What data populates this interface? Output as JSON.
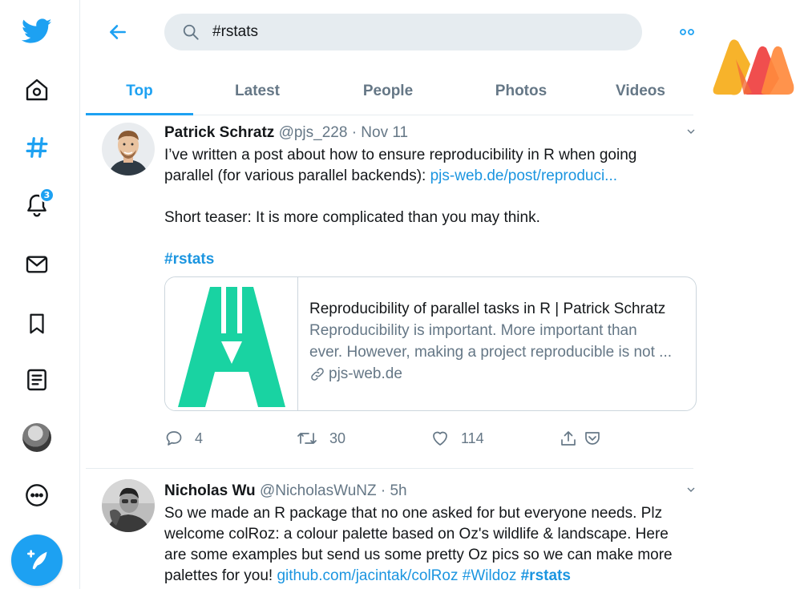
{
  "search": {
    "query": "#rstats",
    "placeholder": "Search Twitter"
  },
  "notifications": {
    "count": "3"
  },
  "tabs": [
    {
      "label": "Top",
      "active": true
    },
    {
      "label": "Latest"
    },
    {
      "label": "People"
    },
    {
      "label": "Photos"
    },
    {
      "label": "Videos"
    }
  ],
  "tweets": [
    {
      "name": "Patrick Schratz",
      "meta": "@pjs_228 · Nov 11",
      "text_line1": "I’ve written a post about how to ensure reproducibility in R when going",
      "text_line2": "parallel (for various parallel backends): ",
      "link": "pjs-web.de/post/reproduci...",
      "teaser": "Short teaser: It is more complicated than you may think.",
      "hashtag": "#rstats",
      "card": {
        "title": "Reproducibility of parallel tasks in R | Patrick Schratz",
        "desc_line1": "Reproducibility is important. More important than",
        "desc_line2": "ever. However, making a project reproducible is not ...",
        "domain": "pjs-web.de"
      },
      "replies": "4",
      "retweets": "30",
      "likes": "114"
    },
    {
      "name": "Nicholas Wu",
      "meta": "@NicholasWuNZ · 5h",
      "line1": "So we made an R package that no one asked for but everyone needs. Plz",
      "line2": "welcome colRoz: a colour palette based on Oz's wildlife & landscape. Here",
      "line3": "are some examples but send us some pretty Oz pics so we can make more",
      "line4_prefix": "palettes for you! ",
      "link": "github.com/jacintak/colRoz",
      "tag1": "#Wildoz",
      "tag2": "#rstats"
    }
  ],
  "colors": {
    "accent": "#1da1f2",
    "link": "#1b95e0",
    "muted": "#657786"
  }
}
